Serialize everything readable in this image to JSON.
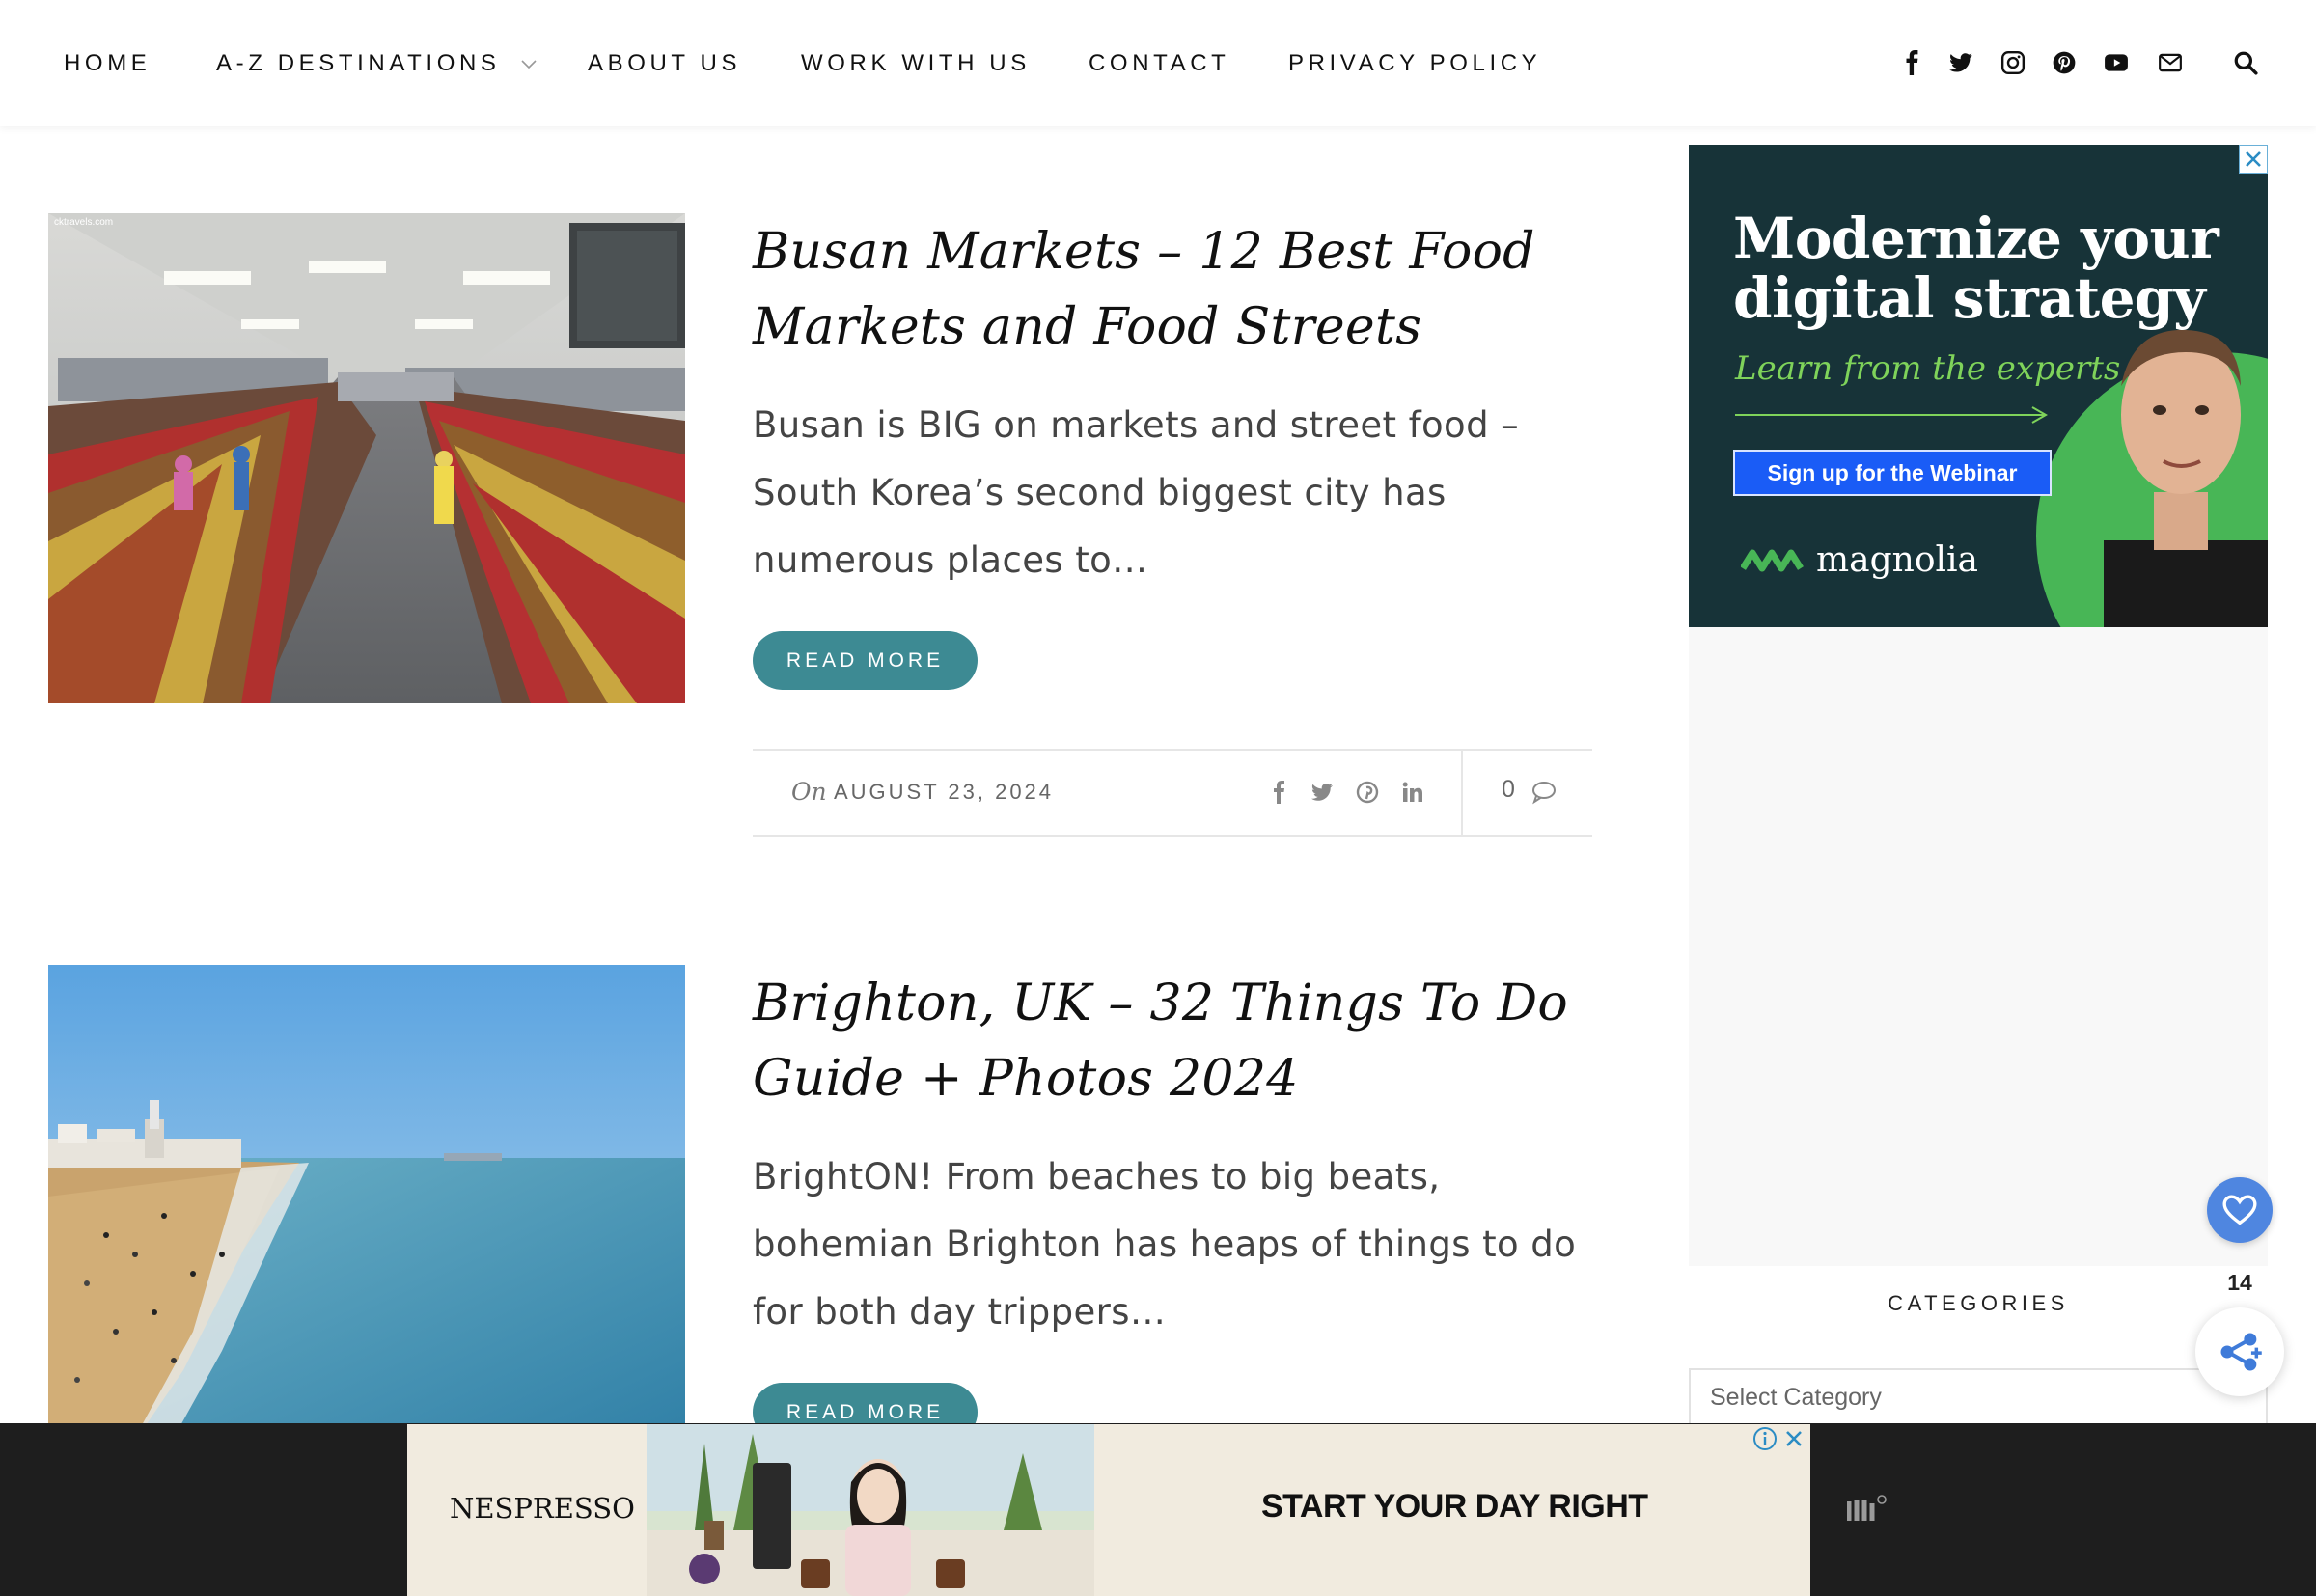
{
  "nav": {
    "items": [
      {
        "label": "HOME"
      },
      {
        "label": "A-Z DESTINATIONS",
        "has_dropdown": true
      },
      {
        "label": "ABOUT US"
      },
      {
        "label": "WORK WITH US"
      },
      {
        "label": "CONTACT"
      },
      {
        "label": "PRIVACY POLICY"
      }
    ],
    "social_icons": [
      "facebook-icon",
      "twitter-icon",
      "instagram-icon",
      "pinterest-icon",
      "youtube-icon",
      "email-icon"
    ],
    "search_icon": "search-icon"
  },
  "posts": [
    {
      "image_watermark": "cktravels.com",
      "title": "Busan Markets – 12 Best Food Markets and Food Streets",
      "excerpt": "Busan is BIG on markets and street food – South Korea’s second biggest city has numerous places to…",
      "read_more": "READ MORE",
      "meta_prefix": "On",
      "date": "AUGUST 23, 2024",
      "comments": "0",
      "share_icons": [
        "facebook-icon",
        "twitter-icon",
        "pinterest-icon",
        "linkedin-icon"
      ]
    },
    {
      "title": "Brighton, UK – 32 Things To Do Guide + Photos 2024",
      "excerpt": "BrightON! From beaches to big beats, bohemian Brighton has heaps of things to do for both day trippers…",
      "read_more": "READ MORE"
    }
  ],
  "sidebar": {
    "ad": {
      "headline": "Modernize your digital strategy",
      "subline": "Learn from the experts",
      "button": "Sign up for the Webinar",
      "brand": "magnolia"
    },
    "categories_heading": "CATEGORIES",
    "category_select_placeholder": "Select Category"
  },
  "floating_share": {
    "count": "14"
  },
  "bottom_ad": {
    "brand": "NESPRESSO",
    "tagline": "START YOUR DAY RIGHT"
  },
  "colors": {
    "accent": "#3d8a93",
    "ad_bg": "#173338",
    "ad_green": "#48b656",
    "ad_button": "#1a5cf6",
    "fab_blue": "#4f86e0"
  }
}
